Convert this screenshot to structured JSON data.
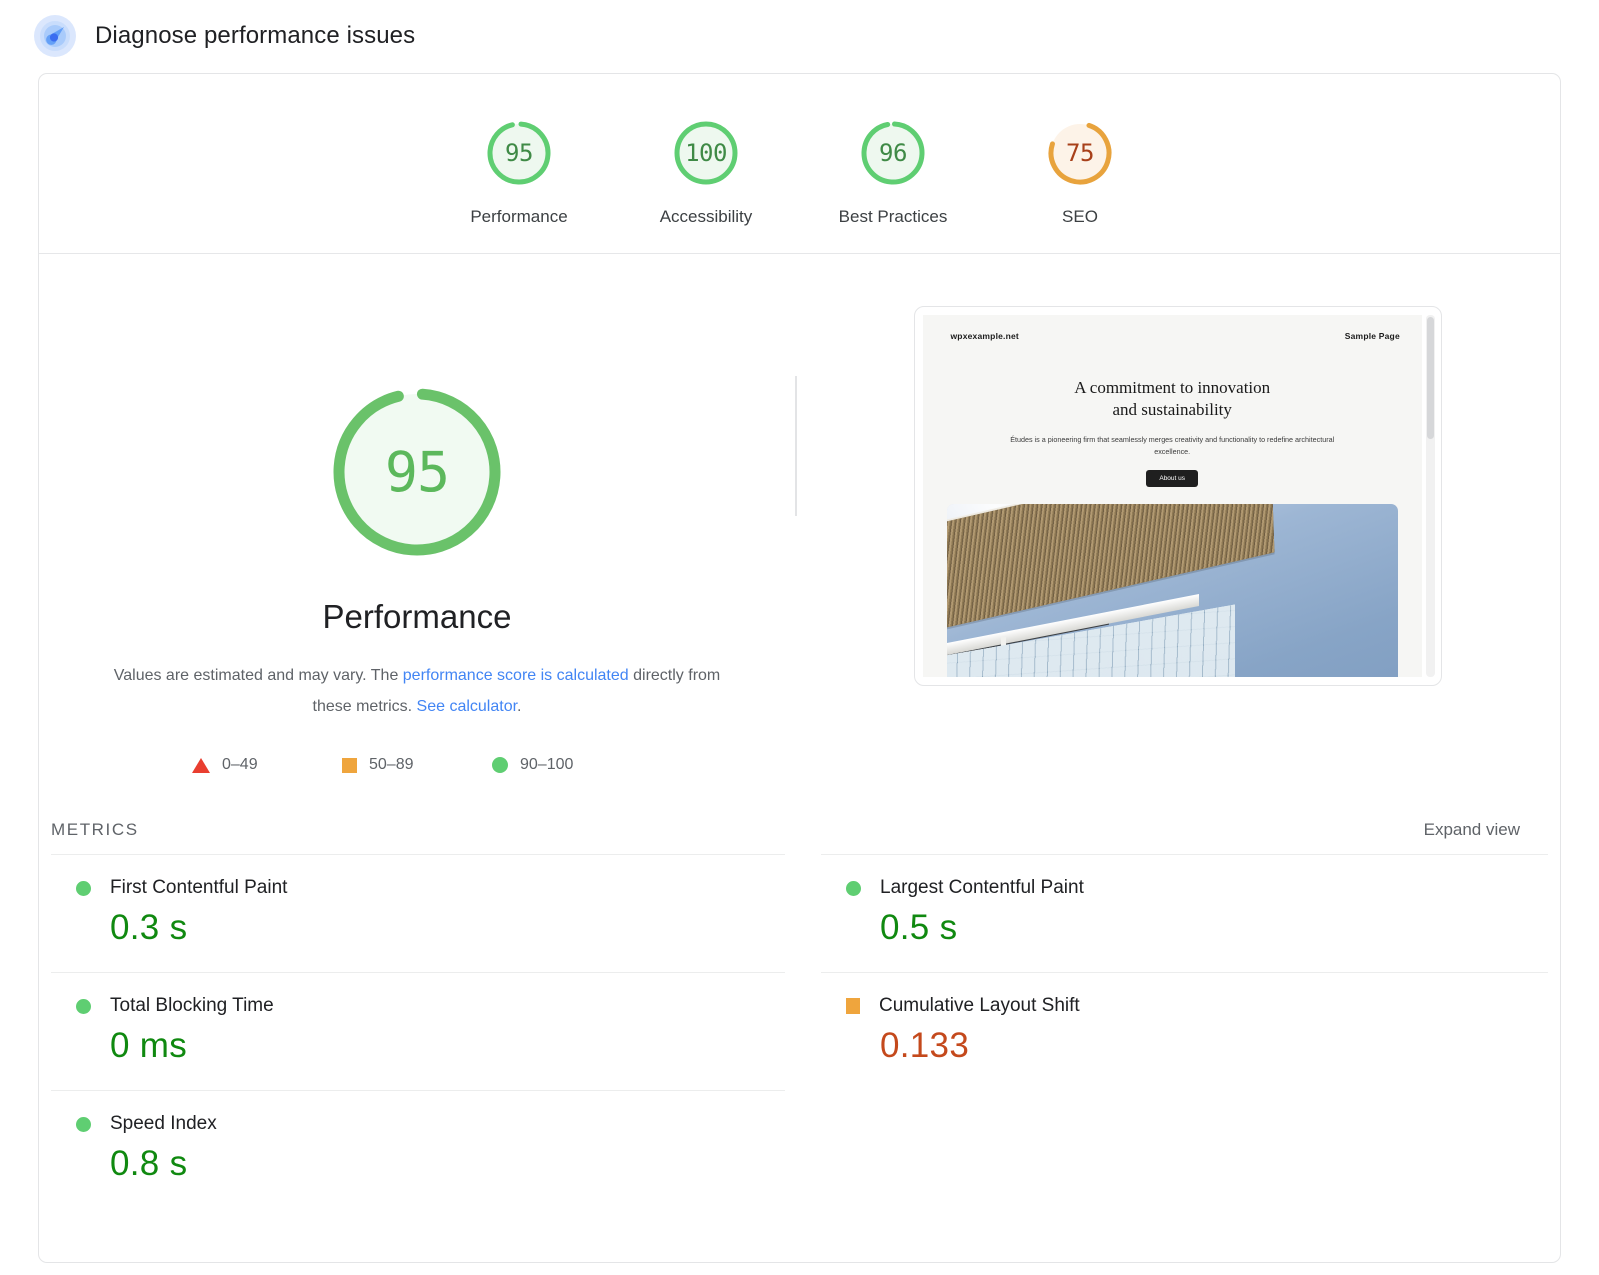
{
  "header": {
    "title": "Diagnose performance issues",
    "icon": "diagnose-speedometer-icon"
  },
  "category_scores": [
    {
      "score": "95",
      "label": "Performance",
      "state": "pass",
      "color": "#5fce72",
      "fill": "#eef8ef",
      "text_color": "#3f8a46"
    },
    {
      "score": "100",
      "label": "Accessibility",
      "state": "pass",
      "color": "#5fce72",
      "fill": "#eef8ef",
      "text_color": "#3f8a46"
    },
    {
      "score": "96",
      "label": "Best Practices",
      "state": "pass",
      "color": "#5fce72",
      "fill": "#eef8ef",
      "text_color": "#3f8a46"
    },
    {
      "score": "75",
      "label": "SEO",
      "state": "average",
      "color": "#e8a33d",
      "fill": "#fdf3e8",
      "text_color": "#a8401a"
    }
  ],
  "selected_category": {
    "score": "95",
    "title": "Performance",
    "color": "#6ac26a",
    "fill": "#f1faf2",
    "text_color": "#5cb85c",
    "description_prefix": "Values are estimated and may vary. The ",
    "link1": "performance score is calculated",
    "description_middle": " directly from these metrics. ",
    "link2": "See calculator",
    "description_suffix": "."
  },
  "legend": [
    {
      "shape": "triangle",
      "range": "0–49",
      "color": "#e93e30"
    },
    {
      "shape": "square",
      "range": "50–89",
      "color": "#efa53d"
    },
    {
      "shape": "circle",
      "range": "90–100",
      "color": "#5fce72"
    }
  ],
  "thumbnail": {
    "brand": "wpxexample.net",
    "nav_link": "Sample Page",
    "heading_line1": "A commitment to innovation",
    "heading_line2": "and sustainability",
    "paragraph": "Études is a pioneering firm that seamlessly merges creativity and functionality to redefine architectural excellence.",
    "button": "About us"
  },
  "metrics_section": {
    "title": "METRICS",
    "expand_label": "Expand view",
    "items": [
      {
        "indicator": "circle",
        "label": "First Contentful Paint",
        "value": "0.3 s",
        "value_class": "v-green"
      },
      {
        "indicator": "circle",
        "label": "Largest Contentful Paint",
        "value": "0.5 s",
        "value_class": "v-green"
      },
      {
        "indicator": "circle",
        "label": "Total Blocking Time",
        "value": "0 ms",
        "value_class": "v-green"
      },
      {
        "indicator": "square",
        "label": "Cumulative Layout Shift",
        "value": "0.133",
        "value_class": "v-orange"
      },
      {
        "indicator": "circle",
        "label": "Speed Index",
        "value": "0.8 s",
        "value_class": "v-green"
      }
    ]
  }
}
